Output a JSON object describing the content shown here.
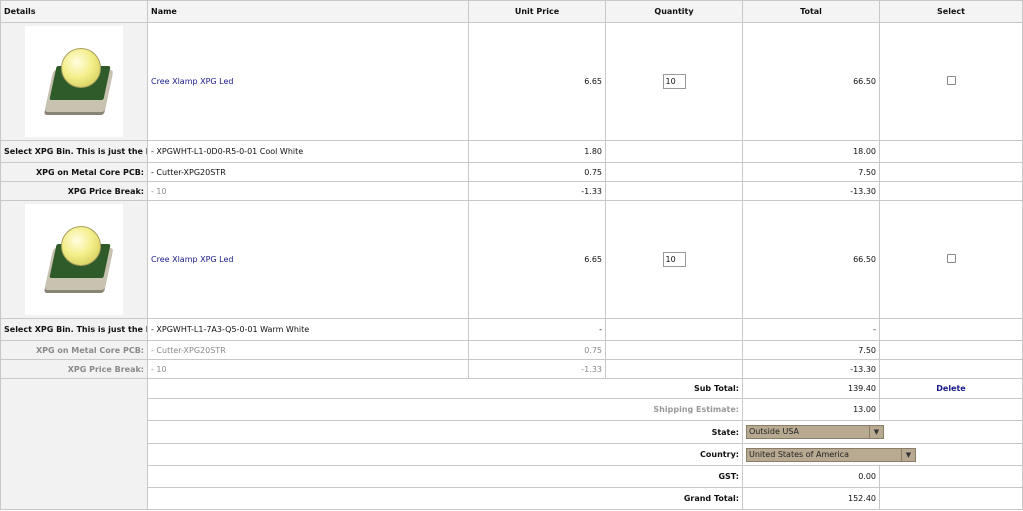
{
  "headers": {
    "details": "Details",
    "name": "Name",
    "unit_price": "Unit Price",
    "quantity": "Quantity",
    "total": "Total",
    "select": "Select"
  },
  "items": [
    {
      "name": "Cree Xlamp XPG Led",
      "unit_price": "6.65",
      "quantity": "10",
      "total": "66.50",
      "options": [
        {
          "label": "Select XPG Bin. This is just the LED Bin, not the qty of leds:",
          "value": "- XPGWHT-L1-0D0-R5-0-01 Cool White",
          "unit_price": "1.80",
          "total": "18.00"
        },
        {
          "label": "XPG on Metal Core PCB:",
          "value": "- Cutter-XPG20STR",
          "unit_price": "0.75",
          "total": "7.50"
        },
        {
          "label": "XPG Price Break:",
          "value": "- 10",
          "unit_price": "-1.33",
          "total": "-13.30"
        }
      ]
    },
    {
      "name": "Cree Xlamp XPG Led",
      "unit_price": "6.65",
      "quantity": "10",
      "total": "66.50",
      "options": [
        {
          "label": "Select XPG Bin. This is just the LED Bin, not the qty of leds:",
          "value": "- XPGWHT-L1-7A3-Q5-0-01 Warm White",
          "unit_price": "-",
          "total": "-"
        },
        {
          "label": "XPG on Metal Core PCB:",
          "value": "- Cutter-XPG20STR",
          "unit_price": "0.75",
          "total": "7.50"
        },
        {
          "label": "XPG Price Break:",
          "value": "- 10",
          "unit_price": "-1.33",
          "total": "-13.30"
        }
      ]
    }
  ],
  "summary": {
    "subtotal_label": "Sub Total:",
    "subtotal": "139.40",
    "delete_label": "Delete",
    "shipping_label": "Shipping Estimate:",
    "shipping": "13.00",
    "state_label": "State:",
    "state_value": "Outside USA",
    "country_label": "Country:",
    "country_value": "United States of America",
    "gst_label": "GST:",
    "gst": "0.00",
    "grand_total_label": "Grand Total:",
    "grand_total": "152.40"
  },
  "icons": {
    "dropdown_arrow": "▼"
  }
}
